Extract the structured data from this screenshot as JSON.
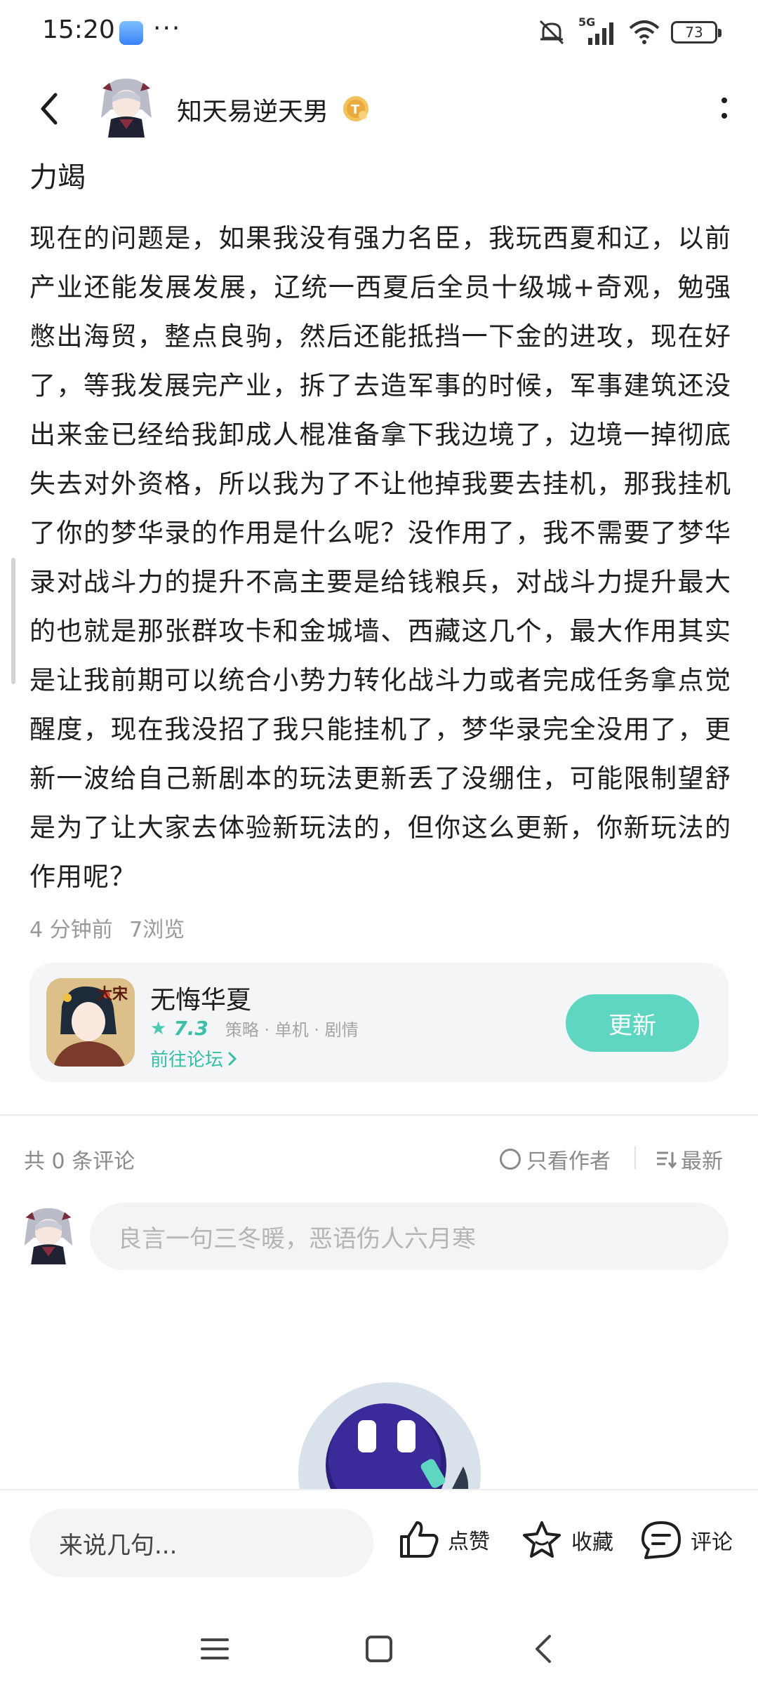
{
  "status": {
    "time": "15:20",
    "dots": "···",
    "network": "5G",
    "battery": "73"
  },
  "header": {
    "author_name": "知天易逆天男"
  },
  "post": {
    "title": "力竭",
    "body": "现在的问题是，如果我没有强力名臣，我玩西夏和辽，以前产业还能发展发展，辽统一西夏后全员十级城+奇观，勉强憋出海贸，整点良驹，然后还能抵挡一下金的进攻，现在好了，等我发展完产业，拆了去造军事的时候，军事建筑还没出来金已经给我卸成人棍准备拿下我边境了，边境一掉彻底失去对外资格，所以我为了不让他掉我要去挂机，那我挂机了你的梦华录的作用是什么呢？没作用了，我不需要了梦华录对战斗力的提升不高主要是给钱粮兵，对战斗力提升最大的也就是那张群攻卡和金城墙、西藏这几个，最大作用其实是让我前期可以统合小势力转化战斗力或者完成任务拿点觉醒度，现在我没招了我只能挂机了，梦华录完全没用了，更新一波给自己新剧本的玩法更新丢了没绷住，可能限制望舒是为了让大家去体验新玩法的，但你这么更新，你新玩法的作用呢？",
    "time_ago": "4 分钟前",
    "views": "7浏览"
  },
  "game_card": {
    "name": "无悔华夏",
    "rating": "7.3",
    "tags": "策略 · 单机 · 剧情",
    "forum_link": "前往论坛",
    "update_label": "更新",
    "icon_text": "大宋"
  },
  "comments": {
    "count_label": "共 0 条评论",
    "only_author_label": "只看作者",
    "sort_label": "最新",
    "input_placeholder": "良言一句三冬暖，恶语伤人六月寒"
  },
  "bottom_bar": {
    "say_placeholder": "来说几句...",
    "like_label": "点赞",
    "favorite_label": "收藏",
    "comment_label": "评论"
  },
  "colors": {
    "accent": "#5ed6c1",
    "accent_text": "#36bfa5",
    "muted": "#8a8a8a"
  }
}
